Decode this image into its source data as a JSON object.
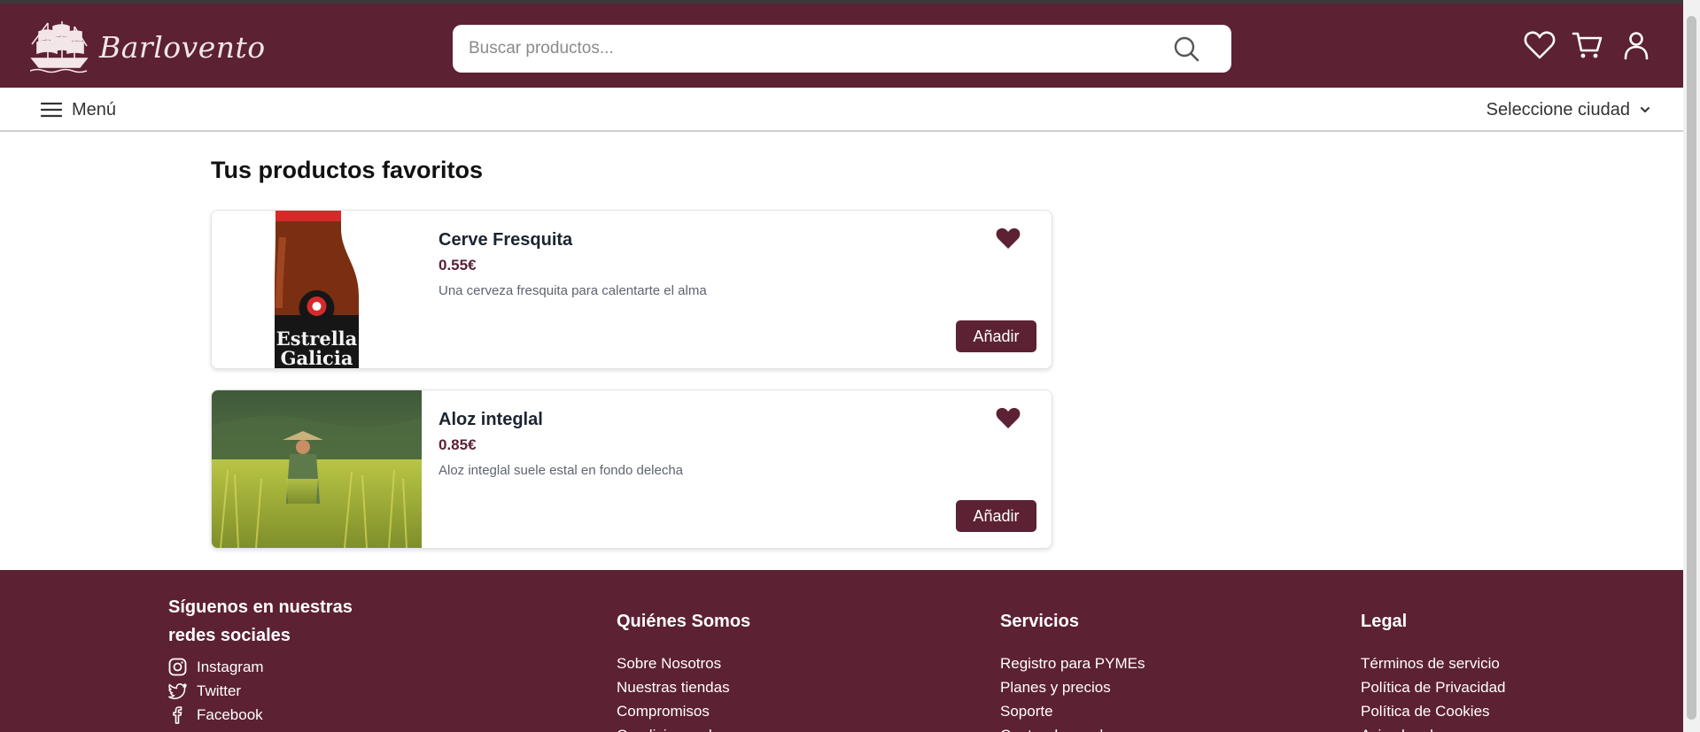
{
  "header": {
    "logo_text": "Barlovento",
    "search_placeholder": "Buscar productos...",
    "icons": [
      "heart-icon",
      "cart-icon",
      "user-icon"
    ]
  },
  "subnav": {
    "menu_label": "Menú",
    "city_label": "Seleccione ciudad"
  },
  "main": {
    "title": "Tus productos favoritos",
    "products": [
      {
        "name": "Cerve Fresquita",
        "price": "0.55€",
        "description": "Una cerveza fresquita para calentarte el alma",
        "add_label": "Añadir",
        "image_text": [
          "Estrella",
          "Galicia"
        ]
      },
      {
        "name": "Aloz integlal",
        "price": "0.85€",
        "description": "Aloz integlal suele estal en fondo delecha",
        "add_label": "Añadir"
      }
    ]
  },
  "footer": {
    "social": {
      "title_line1": "Síguenos en nuestras",
      "title_line2": "redes sociales",
      "links": [
        "Instagram",
        "Twitter",
        "Facebook"
      ]
    },
    "about": {
      "title": "Quiénes Somos",
      "links": [
        "Sobre Nosotros",
        "Nuestras tiendas",
        "Compromisos",
        "Condiciones de uso"
      ]
    },
    "services": {
      "title": "Servicios",
      "links": [
        "Registro para PYMEs",
        "Planes y precios",
        "Soporte",
        "Centro de ayuda"
      ]
    },
    "legal": {
      "title": "Legal",
      "links": [
        "Términos de servicio",
        "Política de Privacidad",
        "Política de Cookies",
        "Aviso legal"
      ]
    }
  },
  "colors": {
    "brand": "#5c2133",
    "header_text": "#f3e6e8"
  }
}
